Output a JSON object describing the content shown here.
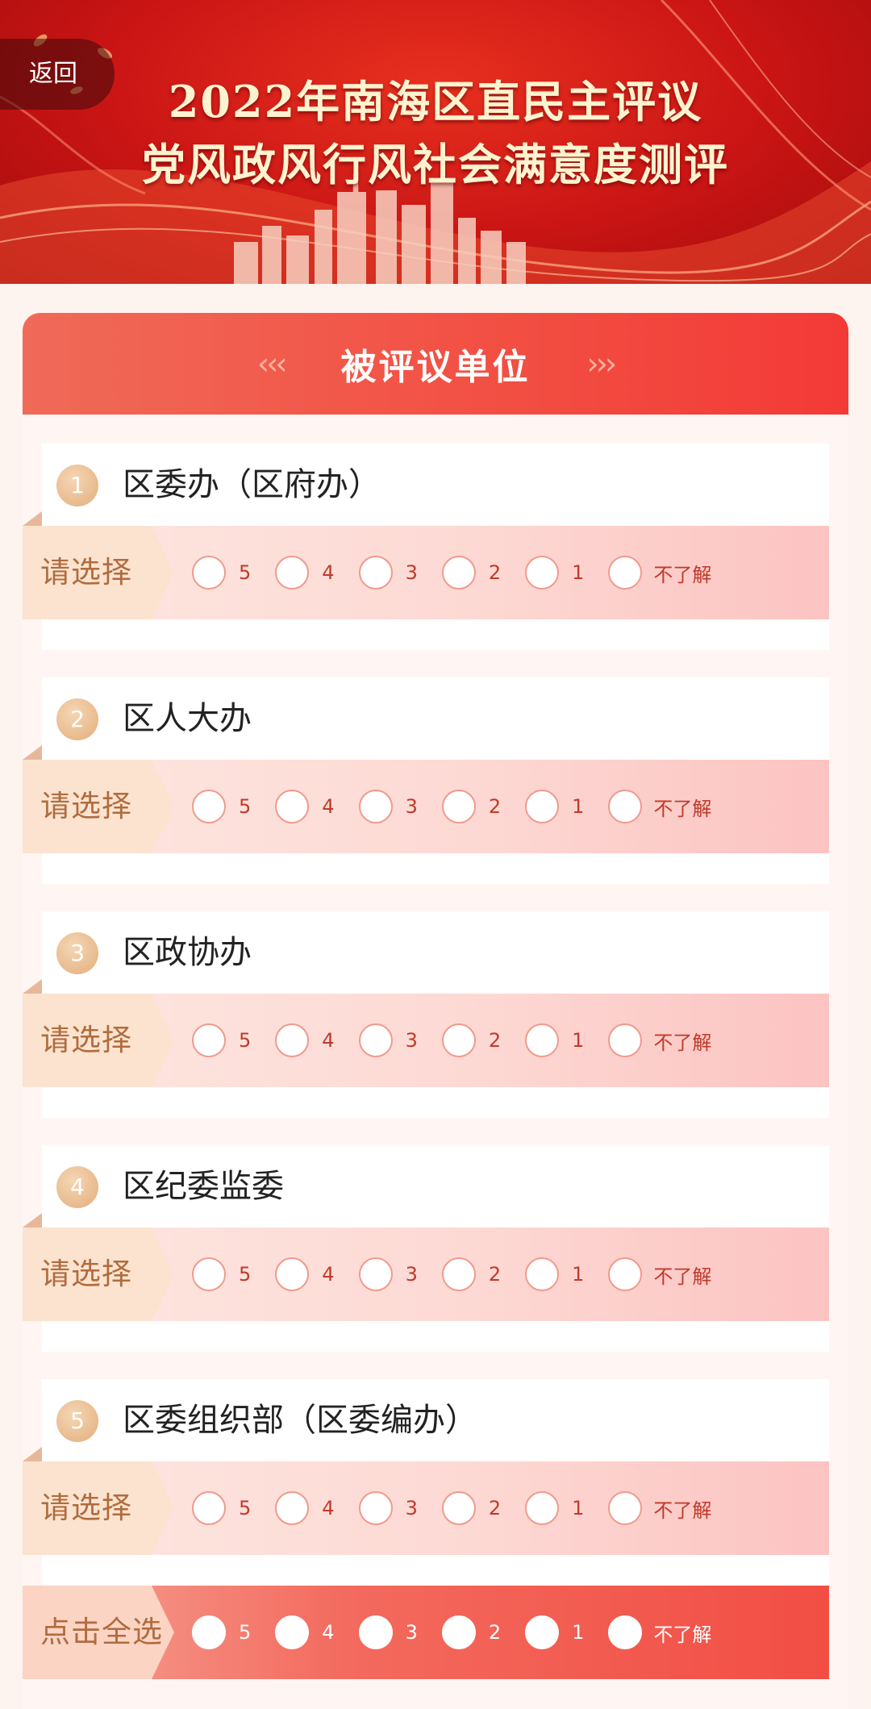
{
  "header": {
    "back_label": "返回",
    "title_line1": "2022年南海区直民主评议",
    "title_line2": "党风政风行风社会满意度测评"
  },
  "section": {
    "title": "被评议单位",
    "left_chevrons": "‹‹‹",
    "right_chevrons": "›››"
  },
  "select_prompt": "请选择",
  "options": [
    "5",
    "4",
    "3",
    "2",
    "1",
    "不了解"
  ],
  "units": [
    {
      "num": "1",
      "name": "区委办（区府办）"
    },
    {
      "num": "2",
      "name": "区人大办"
    },
    {
      "num": "3",
      "name": "区政协办"
    },
    {
      "num": "4",
      "name": "区纪委监委"
    },
    {
      "num": "5",
      "name": "区委组织部（区委编办）"
    }
  ],
  "select_all": {
    "label": "点击全选",
    "options": [
      "5",
      "4",
      "3",
      "2",
      "1",
      "不了解"
    ]
  },
  "colors": {
    "banner_red": "#c91414",
    "header_red": "#f24e42",
    "title_gold": "#fff3cf",
    "prompt_brown": "#b06c3e"
  }
}
